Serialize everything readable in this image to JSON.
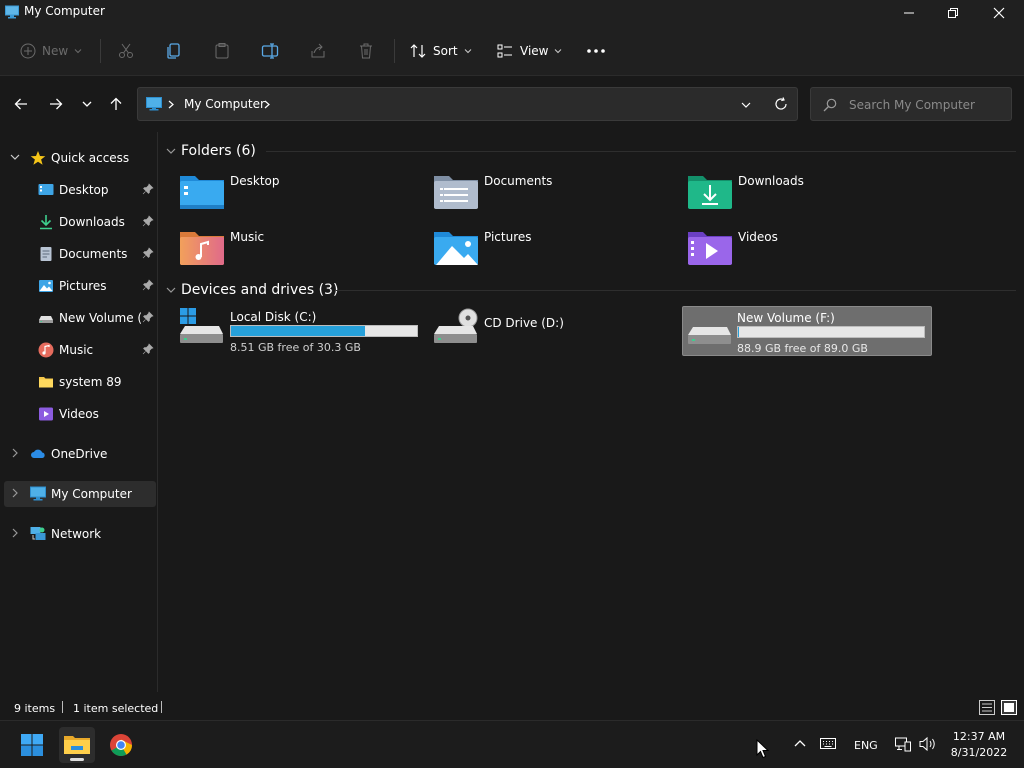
{
  "window": {
    "title": "My Computer"
  },
  "toolbar": {
    "new_label": "New",
    "sort_label": "Sort",
    "view_label": "View"
  },
  "address": {
    "crumb": "My Computer",
    "search_placeholder": "Search My Computer"
  },
  "sidebar": {
    "quick_access": "Quick access",
    "items": [
      {
        "label": "Desktop",
        "pinned": true
      },
      {
        "label": "Downloads",
        "pinned": true
      },
      {
        "label": "Documents",
        "pinned": true
      },
      {
        "label": "Pictures",
        "pinned": true
      },
      {
        "label": "New Volume (F",
        "pinned": true
      },
      {
        "label": "Music",
        "pinned": true
      },
      {
        "label": "system 89",
        "pinned": false
      },
      {
        "label": "Videos",
        "pinned": false
      }
    ],
    "onedrive": "OneDrive",
    "my_computer": "My Computer",
    "network": "Network"
  },
  "content": {
    "folders_header": "Folders (6)",
    "folders": [
      {
        "name": "Desktop"
      },
      {
        "name": "Documents"
      },
      {
        "name": "Downloads"
      },
      {
        "name": "Music"
      },
      {
        "name": "Pictures"
      },
      {
        "name": "Videos"
      }
    ],
    "drives_header": "Devices and drives (3)",
    "drives": [
      {
        "name": "Local Disk (C:)",
        "free": "8.51 GB free of 30.3 GB",
        "used_fraction": 0.72
      },
      {
        "name": "CD Drive (D:)"
      },
      {
        "name": "New Volume (F:)",
        "free": "88.9 GB free of 89.0 GB",
        "used_fraction": 0.001
      }
    ]
  },
  "status": {
    "items": "9 items",
    "selected": "1 item selected"
  },
  "taskbar": {
    "lang": "ENG",
    "time": "12:37 AM",
    "date": "8/31/2022"
  },
  "colors": {
    "accent": "#26a0da",
    "background": "#191919",
    "titlebar": "#202020",
    "selection": "#6e6e6e"
  }
}
